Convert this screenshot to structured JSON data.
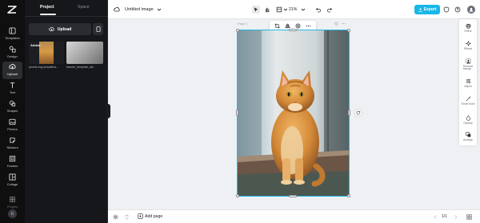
{
  "rail": {
    "items": [
      {
        "label": "Templates",
        "icon": "templates-icon"
      },
      {
        "label": "Design",
        "icon": "design-icon"
      },
      {
        "label": "Upload",
        "icon": "upload-icon"
      },
      {
        "label": "Text",
        "icon": "text-icon"
      },
      {
        "label": "Shapes",
        "icon": "shapes-icon"
      },
      {
        "label": "Photos",
        "icon": "photos-icon"
      },
      {
        "label": "Stickers",
        "icon": "stickers-icon"
      },
      {
        "label": "Frames",
        "icon": "frames-icon"
      },
      {
        "label": "Collage",
        "icon": "collage-icon"
      },
      {
        "label": "Plugins",
        "icon": "plugins-icon"
      }
    ],
    "active": "Upload",
    "avatar": "G"
  },
  "panel": {
    "tabs": [
      "Project",
      "Space"
    ],
    "active_tab": "Project",
    "upload_label": "Upload",
    "assets": [
      {
        "caption": "pexels-evg-kowalievs...",
        "badge": "Added"
      },
      {
        "caption": "banner_template_wit..."
      }
    ]
  },
  "topbar": {
    "title": "Untitled image",
    "zoom": "21%",
    "export_label": "Export"
  },
  "canvas": {
    "page_label": "Page 1"
  },
  "right_rail": {
    "items": [
      {
        "label": "Filters",
        "icon": "filters-icon"
      },
      {
        "label": "Effects",
        "icon": "effects-icon"
      },
      {
        "label": "Remove backgr...",
        "icon": "remove-background-icon"
      },
      {
        "label": "Adjust",
        "icon": "adjust-icon"
      },
      {
        "label": "Smart tools",
        "icon": "smart-tools-icon"
      },
      {
        "label": "Opacity",
        "icon": "opacity-icon"
      },
      {
        "label": "Arrange",
        "icon": "arrange-icon"
      }
    ]
  },
  "bottombar": {
    "add_page_label": "Add page",
    "pager": "1/1"
  },
  "colors": {
    "accent": "#17b7e8",
    "rail_bg": "#0f0f10",
    "panel_bg": "#16171a",
    "canvas_bg": "#eef0f3"
  }
}
